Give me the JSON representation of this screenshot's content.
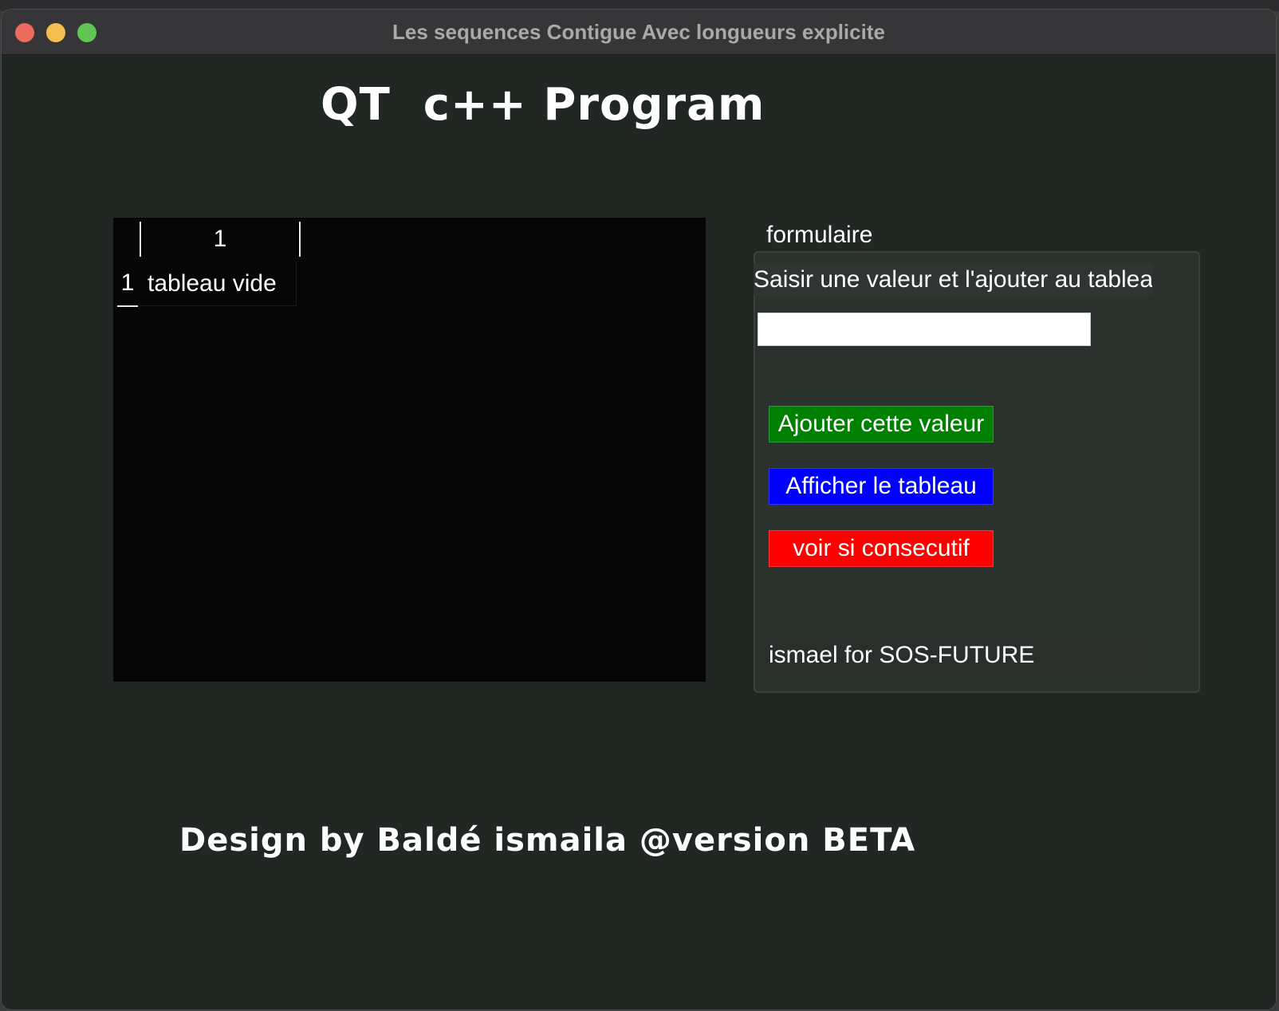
{
  "window": {
    "title": "Les sequences Contigue Avec longueurs explicite",
    "controls": {
      "close_color": "#ed6a5e",
      "minimize_color": "#f5bf4f",
      "maximize_color": "#61c554"
    }
  },
  "main": {
    "heading": "QT  c++ Program",
    "table": {
      "column_headers": [
        "1"
      ],
      "row_headers": [
        "1"
      ],
      "cells": [
        [
          "tableau vide"
        ]
      ]
    },
    "form": {
      "group_title": "formulaire",
      "prompt": "Saisir une valeur et l'ajouter au tableau",
      "input_value": "",
      "buttons": {
        "add": {
          "label": "Ajouter cette valeur",
          "bg": "#008000",
          "fg": "#ffffff"
        },
        "show": {
          "label": "Afficher le  tableau",
          "bg": "#0000ff",
          "fg": "#ffffff"
        },
        "check": {
          "label": "voir si consecutif",
          "bg": "#ff0000",
          "fg": "#ffffff"
        }
      },
      "footer_label": "ismael for SOS-FUTURE"
    },
    "credit": "Design by Baldé ismaila @version BETA"
  }
}
